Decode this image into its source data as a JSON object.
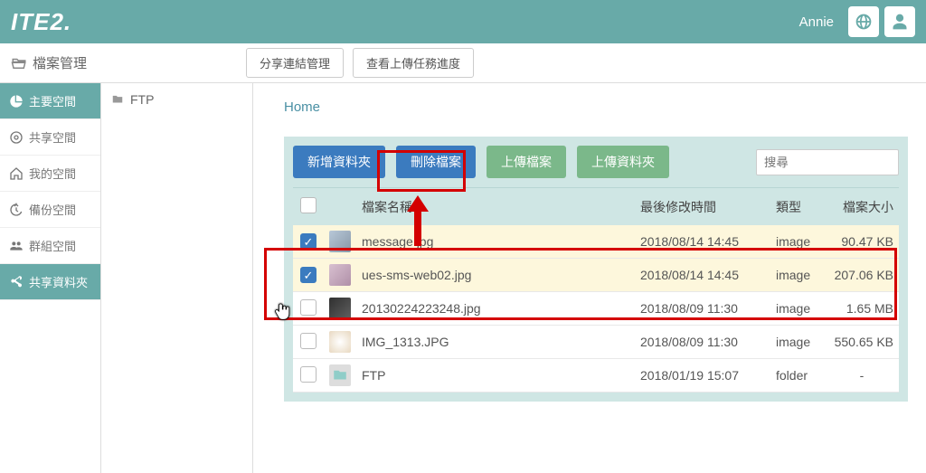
{
  "header": {
    "logo": "ITE2.",
    "username": "Annie"
  },
  "subheader": {
    "title": "檔案管理",
    "share_link_btn": "分享連結管理",
    "upload_progress_btn": "查看上傳任務進度"
  },
  "sidebar": {
    "items": [
      {
        "label": "主要空間",
        "icon": "pie"
      },
      {
        "label": "共享空間",
        "icon": "disc"
      },
      {
        "label": "我的空間",
        "icon": "home"
      },
      {
        "label": "備份空間",
        "icon": "history"
      },
      {
        "label": "群組空間",
        "icon": "group"
      },
      {
        "label": "共享資料夾",
        "icon": "share"
      }
    ]
  },
  "tree": {
    "root": "FTP"
  },
  "breadcrumb": {
    "home": "Home"
  },
  "toolbar": {
    "new_folder": "新增資料夾",
    "delete_file": "刪除檔案",
    "upload_file": "上傳檔案",
    "upload_folder": "上傳資料夾",
    "search_placeholder": "搜尋"
  },
  "columns": {
    "name": "檔案名稱",
    "modified": "最後修改時間",
    "type": "類型",
    "size": "檔案大小"
  },
  "files": [
    {
      "name": "message.jpg",
      "modified": "2018/08/14 14:45",
      "type": "image",
      "size": "90.47 KB",
      "checked": true,
      "thumb": "t1"
    },
    {
      "name": "ues-sms-web02.jpg",
      "modified": "2018/08/14 14:45",
      "type": "image",
      "size": "207.06 KB",
      "checked": true,
      "thumb": "t2"
    },
    {
      "name": "20130224223248.jpg",
      "modified": "2018/08/09 11:30",
      "type": "image",
      "size": "1.65 MB",
      "checked": false,
      "thumb": "t3"
    },
    {
      "name": "IMG_1313.JPG",
      "modified": "2018/08/09 11:30",
      "type": "image",
      "size": "550.65 KB",
      "checked": false,
      "thumb": "t4"
    },
    {
      "name": "FTP",
      "modified": "2018/01/19 15:07",
      "type": "folder",
      "size": "-",
      "checked": false,
      "thumb": "folder"
    }
  ]
}
